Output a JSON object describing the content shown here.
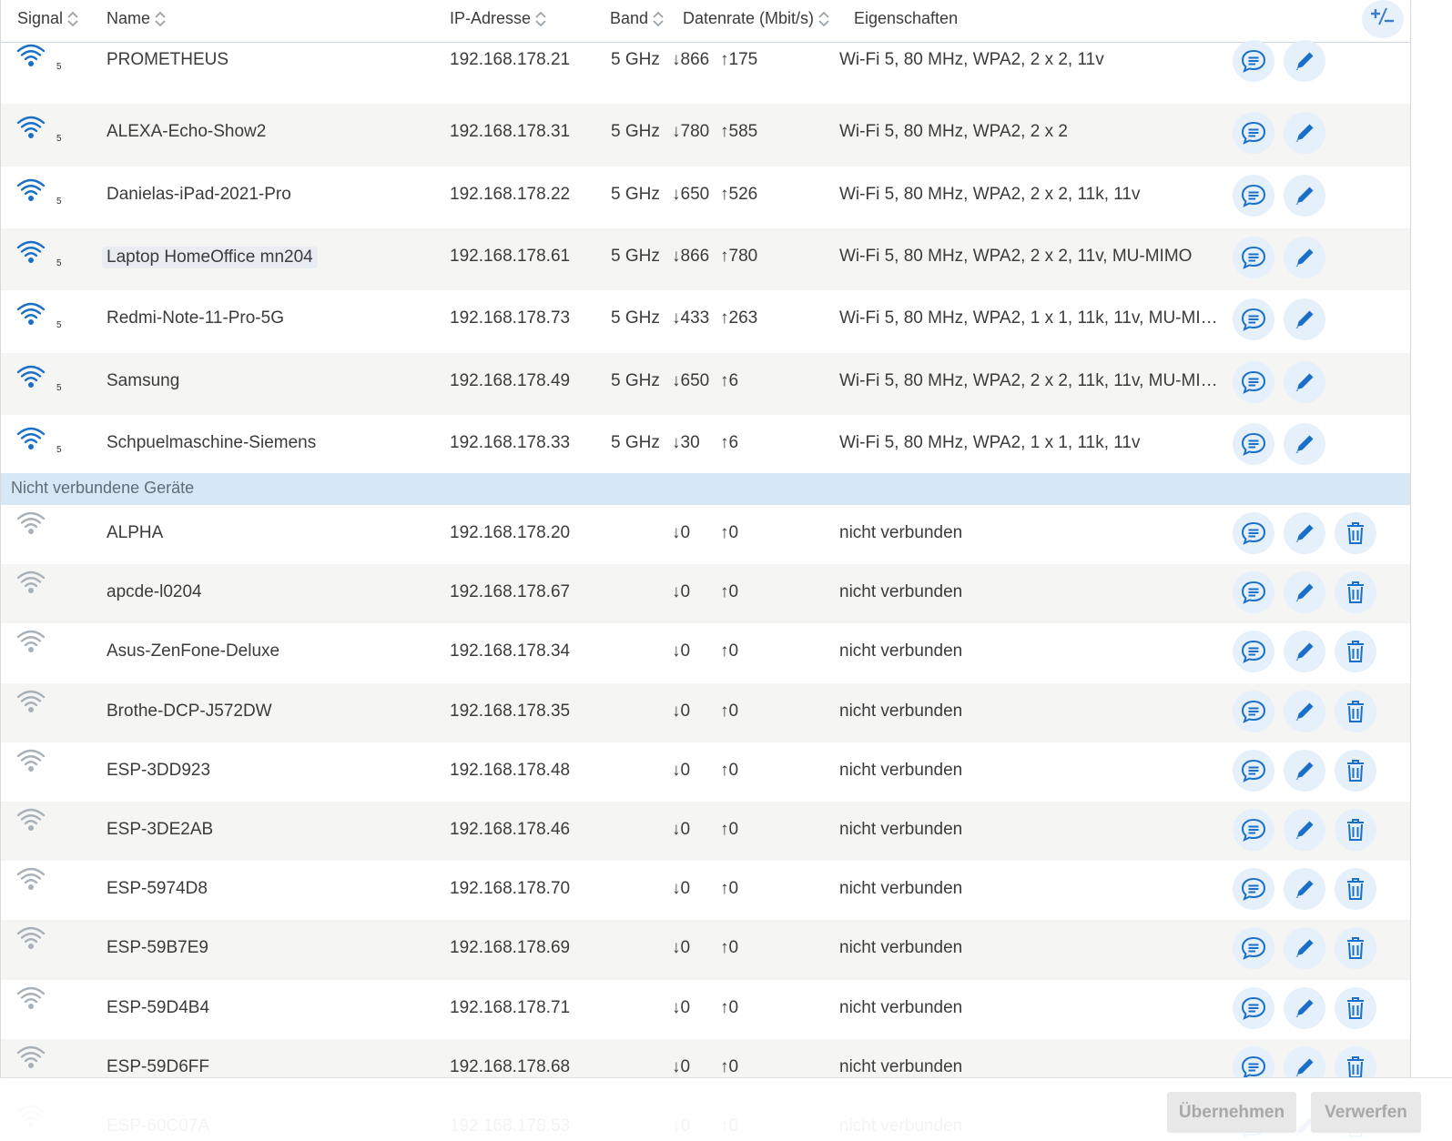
{
  "header": {
    "signal": "Signal",
    "name": "Name",
    "ip": "IP-Adresse",
    "band": "Band",
    "rate": "Datenrate (Mbit/s)",
    "props": "Eigenschaften",
    "plusminus": "+/-"
  },
  "connected": [
    {
      "signal": "5",
      "name": "PROMETHEUS",
      "ip": "192.168.178.21",
      "band": "5 GHz",
      "down": "↓866",
      "up": "↑175",
      "props": "Wi-Fi 5, 80 MHz, WPA2, 2 x 2, 11v"
    },
    {
      "signal": "5",
      "name": "ALEXA-Echo-Show2",
      "ip": "192.168.178.31",
      "band": "5 GHz",
      "down": "↓780",
      "up": "↑585",
      "props": "Wi-Fi 5, 80 MHz, WPA2, 2 x 2"
    },
    {
      "signal": "5",
      "name": "Danielas-iPad-2021-Pro",
      "ip": "192.168.178.22",
      "band": "5 GHz",
      "down": "↓650",
      "up": "↑526",
      "props": "Wi-Fi 5, 80 MHz, WPA2, 2 x 2, 11k, 11v"
    },
    {
      "signal": "5",
      "name": "Laptop HomeOffice mn204",
      "ip": "192.168.178.61",
      "band": "5 GHz",
      "down": "↓866",
      "up": "↑780",
      "props": "Wi-Fi 5, 80 MHz, WPA2, 2 x 2, 11v, MU-MIMO"
    },
    {
      "signal": "5",
      "name": "Redmi-Note-11-Pro-5G",
      "ip": "192.168.178.73",
      "band": "5 GHz",
      "down": "↓433",
      "up": "↑263",
      "props": "Wi-Fi 5, 80 MHz, WPA2, 1 x 1, 11k, 11v, MU-MI…"
    },
    {
      "signal": "5",
      "name": "Samsung",
      "ip": "192.168.178.49",
      "band": "5 GHz",
      "down": "↓650",
      "up": "↑6",
      "props": "Wi-Fi 5, 80 MHz, WPA2, 2 x 2, 11k, 11v, MU-MI…"
    },
    {
      "signal": "5",
      "name": "Schpuelmaschine-Siemens",
      "ip": "192.168.178.33",
      "band": "5 GHz",
      "down": "↓30",
      "up": "↑6",
      "props": "Wi-Fi 5, 80 MHz, WPA2, 1 x 1, 11k, 11v"
    }
  ],
  "section_label": "Nicht verbundene Geräte",
  "disconnected": [
    {
      "name": "ALPHA",
      "ip": "192.168.178.20",
      "down": "↓0",
      "up": "↑0",
      "props": "nicht verbunden"
    },
    {
      "name": "apcde-l0204",
      "ip": "192.168.178.67",
      "down": "↓0",
      "up": "↑0",
      "props": "nicht verbunden"
    },
    {
      "name": "Asus-ZenFone-Deluxe",
      "ip": "192.168.178.34",
      "down": "↓0",
      "up": "↑0",
      "props": "nicht verbunden"
    },
    {
      "name": "Brothe-DCP-J572DW",
      "ip": "192.168.178.35",
      "down": "↓0",
      "up": "↑0",
      "props": "nicht verbunden"
    },
    {
      "name": "ESP-3DD923",
      "ip": "192.168.178.48",
      "down": "↓0",
      "up": "↑0",
      "props": "nicht verbunden"
    },
    {
      "name": "ESP-3DE2AB",
      "ip": "192.168.178.46",
      "down": "↓0",
      "up": "↑0",
      "props": "nicht verbunden"
    },
    {
      "name": "ESP-5974D8",
      "ip": "192.168.178.70",
      "down": "↓0",
      "up": "↑0",
      "props": "nicht verbunden"
    },
    {
      "name": "ESP-59B7E9",
      "ip": "192.168.178.69",
      "down": "↓0",
      "up": "↑0",
      "props": "nicht verbunden"
    },
    {
      "name": "ESP-59D4B4",
      "ip": "192.168.178.71",
      "down": "↓0",
      "up": "↑0",
      "props": "nicht verbunden"
    },
    {
      "name": "ESP-59D6FF",
      "ip": "192.168.178.68",
      "down": "↓0",
      "up": "↑0",
      "props": "nicht verbunden"
    },
    {
      "name": "ESP-60C07A",
      "ip": "192.168.178.53",
      "down": "↓0",
      "up": "↑0",
      "props": "nicht verbunden"
    }
  ],
  "footer": {
    "apply": "Übernehmen",
    "discard": "Verwerfen"
  },
  "icons": {
    "signal_connected": "wifi-strong-icon",
    "signal_disconnected": "wifi-inactive-icon",
    "details": "message-icon",
    "edit": "pencil-icon",
    "delete": "trash-icon",
    "sort": "sort-icon"
  },
  "colors": {
    "accent": "#1a6fc8",
    "button_bg": "#e6f0fa",
    "section_bg": "#d6e7f5",
    "row_shade": "#f5f5f4",
    "wifi_inactive": "#9aa3ab"
  }
}
